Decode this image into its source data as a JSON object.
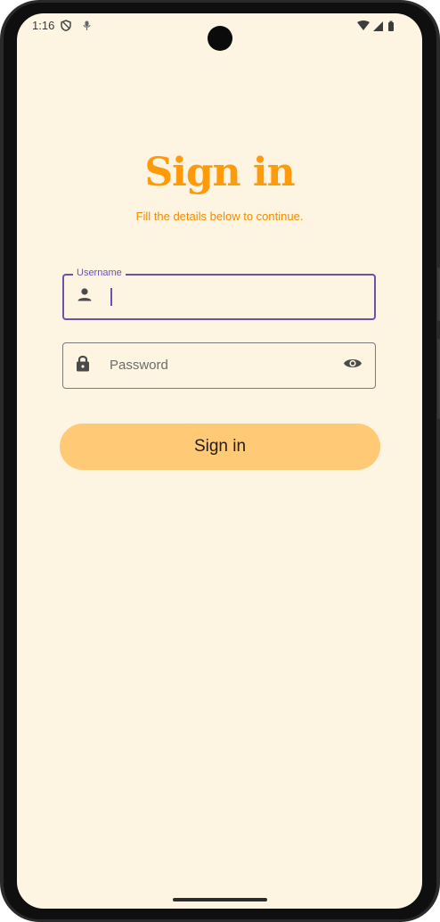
{
  "status_bar": {
    "time": "1:16",
    "icons": [
      "shield-icon",
      "mic-icon",
      "wifi-icon",
      "cell-signal-icon",
      "battery-icon"
    ]
  },
  "login": {
    "title": "Sign in",
    "subtitle": "Fill the details below to continue.",
    "username_label": "Username",
    "username_value": "",
    "password_placeholder": "Password",
    "button_label": "Sign in"
  },
  "colors": {
    "background": "#fdf5e2",
    "title": "#ff9a0a",
    "subtitle": "#f28b00",
    "focus_outline": "#6a54a8",
    "button": "#ffc975"
  }
}
